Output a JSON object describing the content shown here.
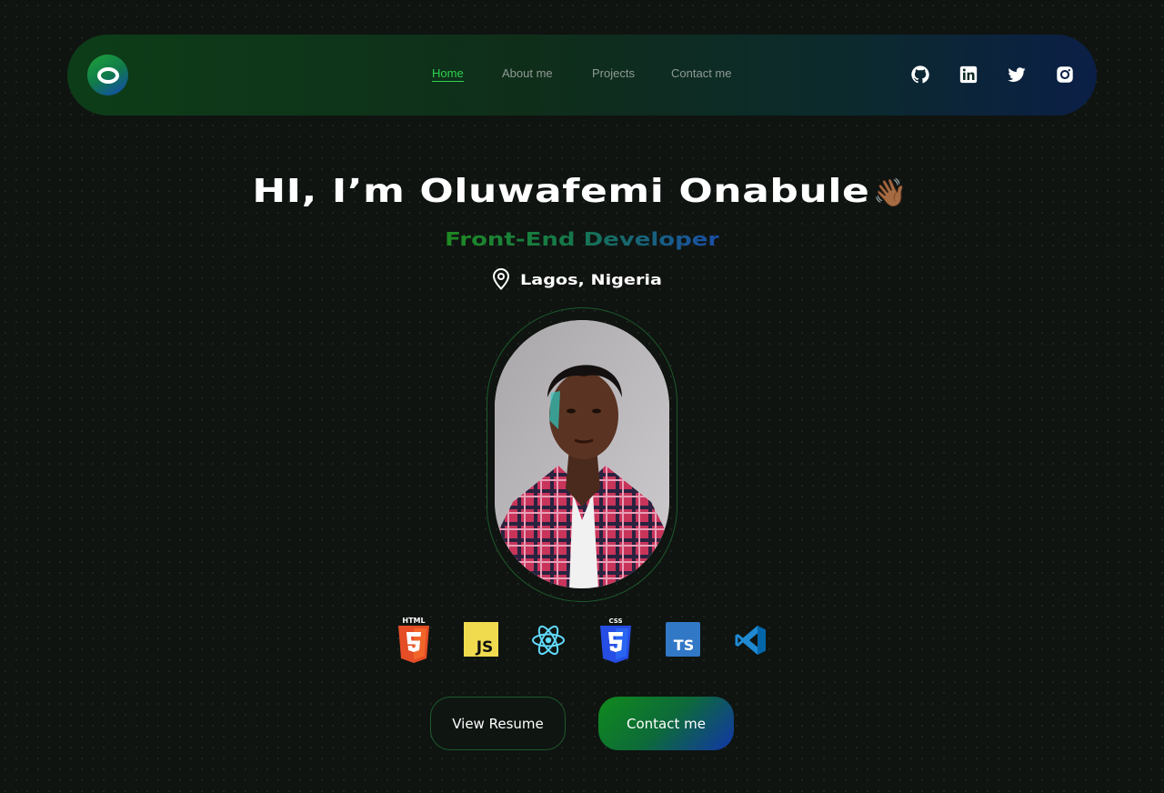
{
  "nav": {
    "logo_icon": "o-ring-logo-icon",
    "links": [
      {
        "label": "Home",
        "active": true
      },
      {
        "label": "About me",
        "active": false
      },
      {
        "label": "Projects",
        "active": false
      },
      {
        "label": "Contact me",
        "active": false
      }
    ],
    "socials": [
      "github-icon",
      "linkedin-icon",
      "twitter-icon",
      "instagram-icon"
    ],
    "active_color": "#2fd14f"
  },
  "hero": {
    "greeting": "HI, I’m Oluwafemi Onabule",
    "wave_emoji": "👋🏾",
    "role": "Front-End Developer",
    "location": "Lagos, Nigeria",
    "location_icon": "map-pin-icon"
  },
  "portrait": {
    "icon": "profile-photo"
  },
  "tech_stack": [
    {
      "name": "html5-icon",
      "label": "HTML",
      "color": "#e44d26"
    },
    {
      "name": "javascript-icon",
      "label": "JS",
      "color": "#f0db4f"
    },
    {
      "name": "react-icon",
      "color": "#61dafb"
    },
    {
      "name": "css3-icon",
      "label": "CSS",
      "color": "#264de4"
    },
    {
      "name": "typescript-icon",
      "label": "TS",
      "color": "#3178c6"
    },
    {
      "name": "vscode-icon",
      "color": "#1f8ad2"
    }
  ],
  "buttons": {
    "resume": "View Resume",
    "contact": "Contact me"
  },
  "colors": {
    "background": "#0f1411",
    "accent_green": "#108a1c",
    "accent_blue": "#1236a8"
  }
}
